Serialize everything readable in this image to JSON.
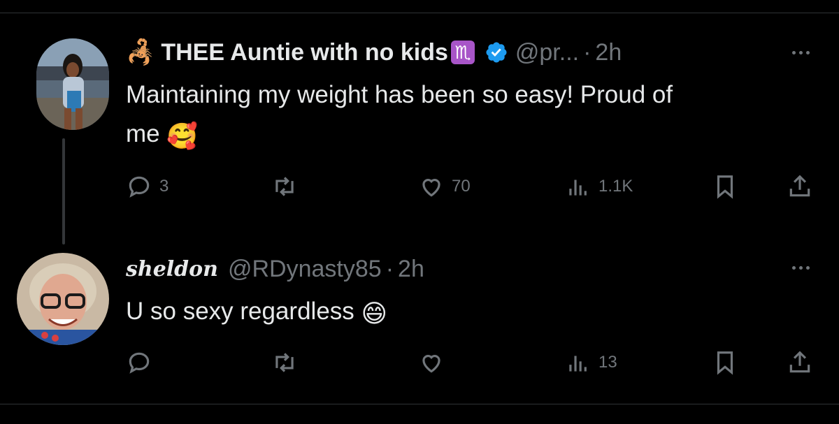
{
  "tweet1": {
    "emoji_prefix": "🦂",
    "name": "THEE Auntie with no kids",
    "sign": "♏",
    "handle": "@pr...",
    "separator": "·",
    "time": "2h",
    "text": "Maintaining my weight has been so easy! Proud of",
    "text_line2": "me",
    "text_emoji": "🥰",
    "replies": "3",
    "retweets": "",
    "likes": "70",
    "views": "1.1K"
  },
  "tweet2": {
    "name": "sheldon",
    "handle": "@RDynasty85",
    "separator": "·",
    "time": "2h",
    "text": "U so sexy regardless",
    "text_emoji": "😄",
    "replies": "",
    "retweets": "",
    "likes": "",
    "views": "13"
  },
  "colors": {
    "background": "#000000",
    "text": "#e7e9ea",
    "secondary": "#71767b",
    "verified": "#1d9bf0",
    "zodiac": "#a855c8"
  },
  "icons": [
    "reply-icon",
    "retweet-icon",
    "like-icon",
    "views-icon",
    "bookmark-icon",
    "share-icon",
    "verified-badge-icon",
    "more-icon"
  ]
}
